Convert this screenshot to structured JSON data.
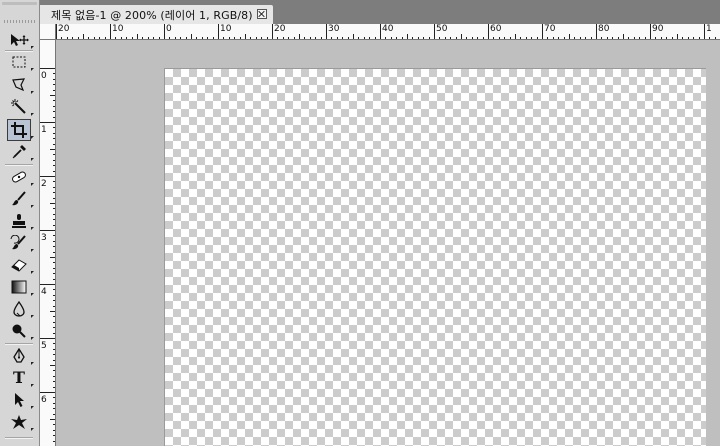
{
  "document": {
    "tab_title": "제목 없음-1 @ 200% (레이어 1, RGB/8)"
  },
  "ruler": {
    "h_labels": [
      "20",
      "10",
      "0",
      "10",
      "20",
      "30",
      "40",
      "50",
      "60",
      "70",
      "80",
      "90",
      "1"
    ],
    "v_labels": [
      "0",
      "1",
      "2",
      "3",
      "4",
      "5",
      "6"
    ]
  },
  "tools": [
    {
      "name": "move-tool",
      "icon": "move-icon"
    },
    {
      "name": "marquee-tool",
      "icon": "rectangle-marquee-icon"
    },
    {
      "name": "lasso-tool",
      "icon": "lasso-icon"
    },
    {
      "name": "quick-selection-tool",
      "icon": "magic-wand-icon"
    },
    {
      "name": "crop-tool",
      "icon": "crop-icon",
      "active": true
    },
    {
      "name": "eyedropper-tool",
      "icon": "eyedropper-icon"
    },
    {
      "name": "spot-healing-tool",
      "icon": "bandage-icon"
    },
    {
      "name": "brush-tool",
      "icon": "brush-icon"
    },
    {
      "name": "clone-stamp-tool",
      "icon": "stamp-icon"
    },
    {
      "name": "history-brush-tool",
      "icon": "history-brush-icon"
    },
    {
      "name": "eraser-tool",
      "icon": "eraser-icon"
    },
    {
      "name": "gradient-tool",
      "icon": "gradient-icon"
    },
    {
      "name": "blur-tool",
      "icon": "blur-drop-icon"
    },
    {
      "name": "dodge-tool",
      "icon": "dodge-icon"
    },
    {
      "name": "pen-tool",
      "icon": "pen-icon"
    },
    {
      "name": "type-tool",
      "icon": "type-icon",
      "label": "T"
    },
    {
      "name": "path-selection-tool",
      "icon": "arrow-icon"
    },
    {
      "name": "shape-tool",
      "icon": "custom-shape-icon"
    }
  ],
  "colors": {
    "toolbox_bg": "#d6d6d6",
    "pasteboard": "#bfbfbf",
    "active_tool": "#b8c4d4",
    "checker": "#cccccc"
  }
}
